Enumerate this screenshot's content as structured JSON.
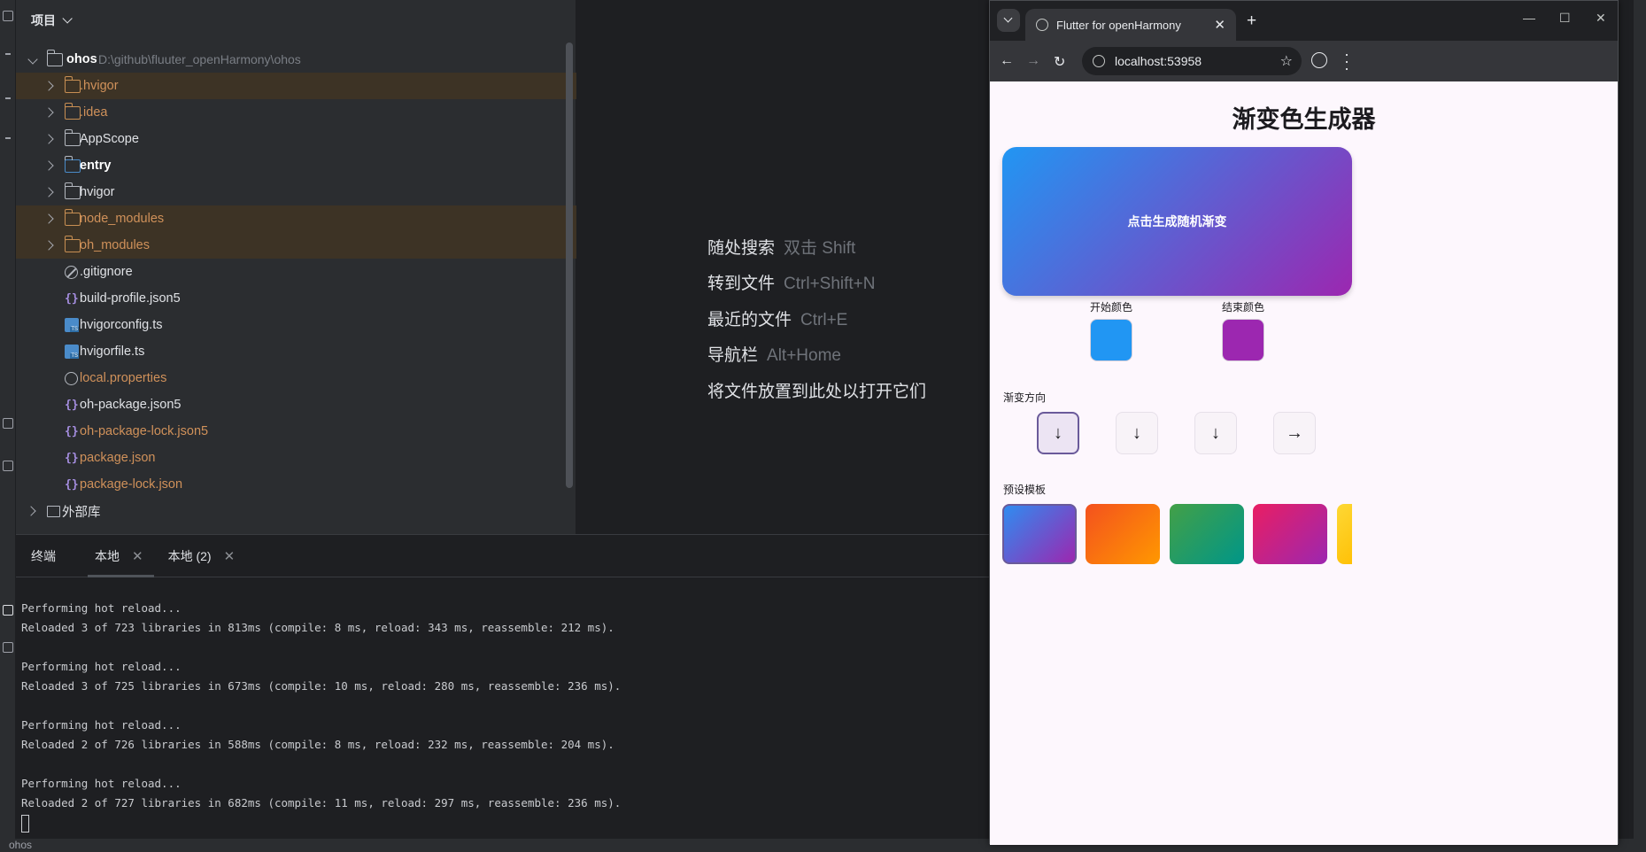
{
  "project_panel": {
    "title": "项目",
    "tree": [
      {
        "name": "ohos",
        "path": "D:\\github\\fluuter_openHarmony\\ohos"
      },
      {
        "name": ".hvigor"
      },
      {
        "name": ".idea"
      },
      {
        "name": "AppScope"
      },
      {
        "name": "entry"
      },
      {
        "name": "hvigor"
      },
      {
        "name": "node_modules"
      },
      {
        "name": "oh_modules"
      },
      {
        "name": ".gitignore"
      },
      {
        "name": "build-profile.json5"
      },
      {
        "name": "hvigorconfig.ts"
      },
      {
        "name": "hvigorfile.ts"
      },
      {
        "name": "local.properties"
      },
      {
        "name": "oh-package.json5"
      },
      {
        "name": "oh-package-lock.json5"
      },
      {
        "name": "package.json"
      },
      {
        "name": "package-lock.json"
      },
      {
        "name": "外部库"
      }
    ]
  },
  "editor_hints": [
    {
      "label": "随处搜索",
      "key": "双击 Shift"
    },
    {
      "label": "转到文件",
      "key": "Ctrl+Shift+N"
    },
    {
      "label": "最近的文件",
      "key": "Ctrl+E"
    },
    {
      "label": "导航栏",
      "key": "Alt+Home"
    },
    {
      "label": "将文件放置到此处以打开它们",
      "key": ""
    }
  ],
  "terminal": {
    "tabs": [
      "终端",
      "本地",
      "本地 (2)"
    ],
    "lines": [
      "Performing hot reload...",
      "Reloaded 3 of 723 libraries in 813ms (compile: 8 ms, reload: 343 ms, reassemble: 212 ms).",
      "",
      "Performing hot reload...",
      "Reloaded 3 of 725 libraries in 673ms (compile: 10 ms, reload: 280 ms, reassemble: 236 ms).",
      "",
      "Performing hot reload...",
      "Reloaded 2 of 726 libraries in 588ms (compile: 8 ms, reload: 232 ms, reassemble: 204 ms).",
      "",
      "Performing hot reload...",
      "Reloaded 2 of 727 libraries in 682ms (compile: 11 ms, reload: 297 ms, reassemble: 236 ms)."
    ]
  },
  "statusbar": {
    "project": "ohos"
  },
  "browser": {
    "tab_title": "Flutter for openHarmony",
    "url": "localhost:53958",
    "app": {
      "title": "渐变色生成器",
      "preview_text": "点击生成随机渐变",
      "start_label": "开始颜色",
      "end_label": "结束颜色",
      "direction_label": "渐变方向",
      "preset_label": "预设模板",
      "colors": {
        "start": "#2196f3",
        "end": "#9c27b0"
      },
      "directions": [
        "↓",
        "↓",
        "↓",
        "→"
      ],
      "presets": [
        [
          "#2f8cf0",
          "#9c27b0"
        ],
        [
          "#f4511e",
          "#ff9800"
        ],
        [
          "#43a047",
          "#009688"
        ],
        [
          "#e91e63",
          "#9c27b0"
        ],
        [
          "#fdd835",
          "#ffc107"
        ]
      ]
    }
  }
}
